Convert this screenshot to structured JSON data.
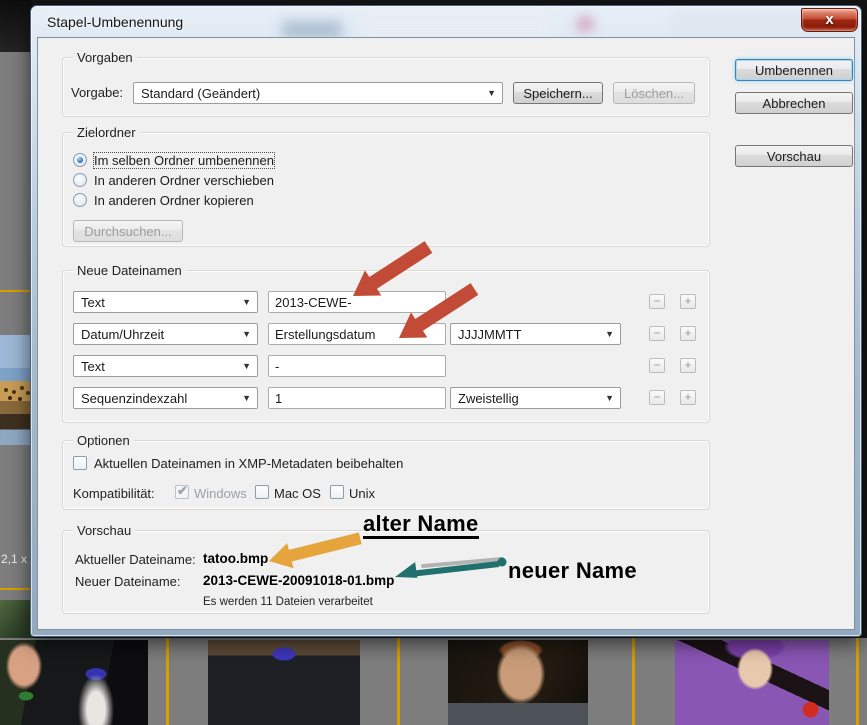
{
  "window": {
    "title": "Stapel-Umbenennung",
    "close_icon": "x"
  },
  "icons": {
    "dropdown_arrow": "▼",
    "checkmark": "✔",
    "minus": "−",
    "plus": "+"
  },
  "action_buttons": {
    "rename": "Umbenennen",
    "cancel": "Abbrechen",
    "preview": "Vorschau"
  },
  "vorgaben": {
    "group_label": "Vorgaben",
    "preset_label": "Vorgabe:",
    "preset_value": "Standard (Geändert)",
    "save_button": "Speichern...",
    "delete_button": "Löschen..."
  },
  "zielordner": {
    "group_label": "Zielordner",
    "options": [
      {
        "label": "Im selben Ordner umbenennen",
        "selected": true
      },
      {
        "label": "In anderen Ordner verschieben",
        "selected": false
      },
      {
        "label": "In anderen Ordner kopieren",
        "selected": false
      }
    ],
    "browse_button": "Durchsuchen..."
  },
  "neue_dateinamen": {
    "group_label": "Neue Dateinamen",
    "rows": [
      {
        "type": "Text",
        "value": "2013-CEWE-"
      },
      {
        "type": "Datum/Uhrzeit",
        "value": "Erstellungsdatum",
        "format": "JJJJMMTT"
      },
      {
        "type": "Text",
        "value": "-"
      },
      {
        "type": "Sequenzindexzahl",
        "value": "1",
        "format": "Zweistellig"
      }
    ]
  },
  "optionen": {
    "group_label": "Optionen",
    "keep_filename_label": "Aktuellen Dateinamen in XMP-Metadaten beibehalten",
    "keep_filename_checked": false,
    "compatibility_label": "Kompatibilität:",
    "compat_options": [
      {
        "label": "Windows",
        "checked": true,
        "disabled": true
      },
      {
        "label": "Mac OS",
        "checked": false,
        "disabled": false
      },
      {
        "label": "Unix",
        "checked": false,
        "disabled": false
      }
    ]
  },
  "vorschau": {
    "group_label": "Vorschau",
    "current_name_label": "Aktueller Dateiname:",
    "current_name_value": "tatoo.bmp",
    "new_name_label": "Neuer Dateiname:",
    "new_name_value": "2013-CEWE-20091018-01.bmp",
    "process_note": "Es werden 11 Dateien verarbeitet"
  },
  "annotations": {
    "old_name": "alter Name",
    "new_name": "neuer Name",
    "red_arrow_color": "#c14b36",
    "orange_arrow_color": "#e5a43c",
    "teal_arrow_color": "#20716e"
  },
  "background": {
    "size_text": "2,1 x"
  },
  "colors": {
    "accent_line": "#d89e00",
    "dialog_bg": "#f0f0f0",
    "close_button_red": "#a02613"
  }
}
